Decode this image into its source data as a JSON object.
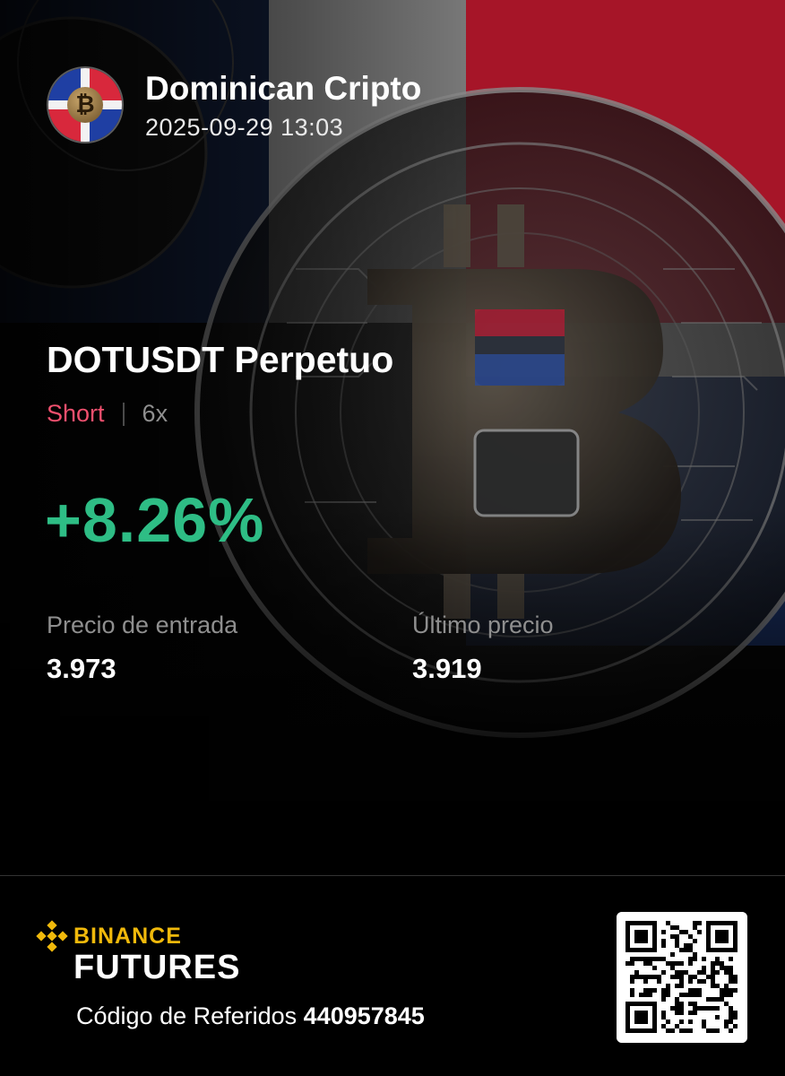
{
  "header": {
    "user_name": "Dominican Cripto",
    "timestamp": "2025-09-29 13:03"
  },
  "position": {
    "pair": "DOTUSDT Perpetuo",
    "side": "Short",
    "leverage": "6x",
    "roi": "+8.26%",
    "entry_price_label": "Precio de entrada",
    "entry_price": "3.973",
    "last_price_label": "Último precio",
    "last_price": "3.919"
  },
  "footer": {
    "brand": "BINANCE",
    "product": "FUTURES",
    "referral_label": "Código de Referidos",
    "referral_code": "440957845"
  },
  "colors": {
    "background": "#000000",
    "profit": "#2ebd85",
    "short": "#f0506e",
    "binance_yellow": "#f0b90b",
    "muted_text": "#8f8f8f"
  },
  "icons": {
    "avatar": "bitcoin-dominican-flag-avatar",
    "background": "bitcoin-coin-dominican-flag-art",
    "logo": "binance-diamond-logo",
    "qr": "qr-code"
  }
}
